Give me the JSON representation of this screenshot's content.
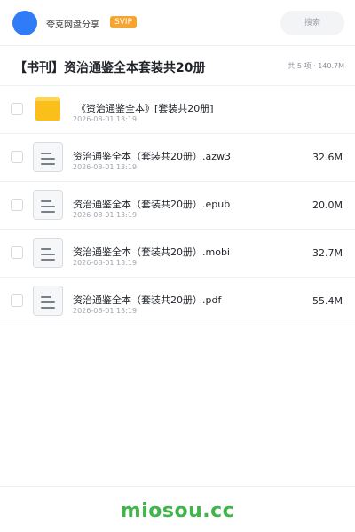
{
  "header": {
    "brand": "夸克网盘分享",
    "badge": "SVIP",
    "search_label": "搜索",
    "avatar_color": "#2f7cf6"
  },
  "share": {
    "title": "【书刊】资治通鉴全本套装共20册",
    "summary": "共 5 项 · 140.7M"
  },
  "files": [
    {
      "type": "folder",
      "icon": "folder-icon",
      "name": "《资治通鉴全本》[套装共20册]",
      "date": "2026-08-01 13:19",
      "size": ""
    },
    {
      "type": "file",
      "icon": "document-icon",
      "name": "资治通鉴全本（套装共20册）.azw3",
      "date": "2026-08-01 13:19",
      "size": "32.6M"
    },
    {
      "type": "file",
      "icon": "document-icon",
      "name": "资治通鉴全本（套装共20册）.epub",
      "date": "2026-08-01 13:19",
      "size": "20.0M"
    },
    {
      "type": "file",
      "icon": "document-icon",
      "name": "资治通鉴全本（套装共20册）.mobi",
      "date": "2026-08-01 13:19",
      "size": "32.7M"
    },
    {
      "type": "file",
      "icon": "document-icon",
      "name": "资治通鉴全本（套装共20册）.pdf",
      "date": "2026-08-01 13:19",
      "size": "55.4M"
    }
  ],
  "footer": {
    "watermark": "miosou.cc",
    "watermark_color": "#3fb54a"
  }
}
